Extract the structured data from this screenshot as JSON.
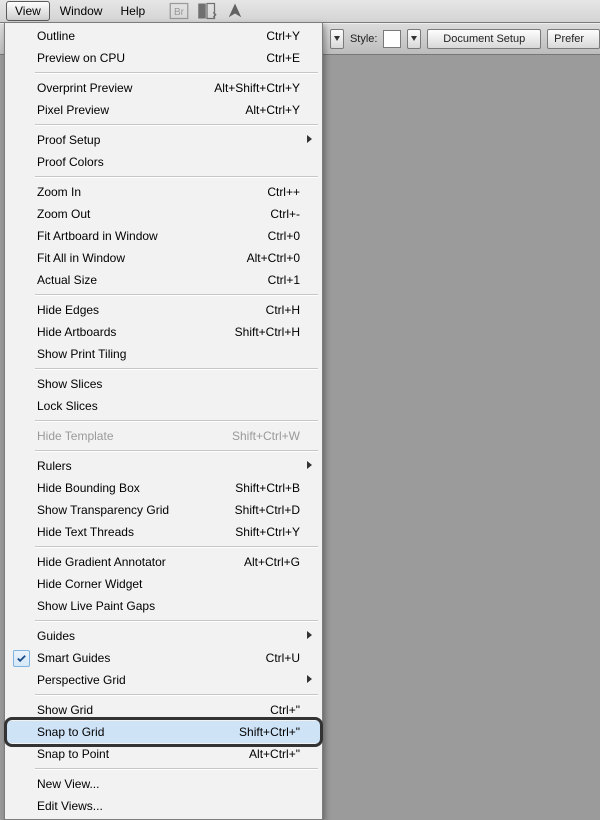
{
  "menubar": {
    "view": "View",
    "window": "Window",
    "help": "Help"
  },
  "toolbar": {
    "style_label": "Style:",
    "document_setup": "Document Setup",
    "preferences": "Prefer"
  },
  "menu": {
    "outline": "Outline",
    "outline_sc": "Ctrl+Y",
    "previewcpu": "Preview on CPU",
    "previewcpu_sc": "Ctrl+E",
    "overprint": "Overprint Preview",
    "overprint_sc": "Alt+Shift+Ctrl+Y",
    "pixel": "Pixel Preview",
    "pixel_sc": "Alt+Ctrl+Y",
    "proofsetup": "Proof Setup",
    "proofcolors": "Proof Colors",
    "zoomin": "Zoom In",
    "zoomin_sc": "Ctrl++",
    "zoomout": "Zoom Out",
    "zoomout_sc": "Ctrl+-",
    "fitab": "Fit Artboard in Window",
    "fitab_sc": "Ctrl+0",
    "fitall": "Fit All in Window",
    "fitall_sc": "Alt+Ctrl+0",
    "actual": "Actual Size",
    "actual_sc": "Ctrl+1",
    "hideedges": "Hide Edges",
    "hideedges_sc": "Ctrl+H",
    "hideab": "Hide Artboards",
    "hideab_sc": "Shift+Ctrl+H",
    "printtile": "Show Print Tiling",
    "showslices": "Show Slices",
    "lockslices": "Lock Slices",
    "hidetmpl": "Hide Template",
    "hidetmpl_sc": "Shift+Ctrl+W",
    "rulers": "Rulers",
    "hidebb": "Hide Bounding Box",
    "hidebb_sc": "Shift+Ctrl+B",
    "showtg": "Show Transparency Grid",
    "showtg_sc": "Shift+Ctrl+D",
    "hidett": "Hide Text Threads",
    "hidett_sc": "Shift+Ctrl+Y",
    "hidega": "Hide Gradient Annotator",
    "hidega_sc": "Alt+Ctrl+G",
    "hidecw": "Hide Corner Widget",
    "showlpg": "Show Live Paint Gaps",
    "guides": "Guides",
    "smartg": "Smart Guides",
    "smartg_sc": "Ctrl+U",
    "persp": "Perspective Grid",
    "showgrid": "Show Grid",
    "showgrid_sc": "Ctrl+\"",
    "snapgrid": "Snap to Grid",
    "snapgrid_sc": "Shift+Ctrl+\"",
    "snappt": "Snap to Point",
    "snappt_sc": "Alt+Ctrl+\"",
    "newview": "New View...",
    "editviews": "Edit Views..."
  }
}
